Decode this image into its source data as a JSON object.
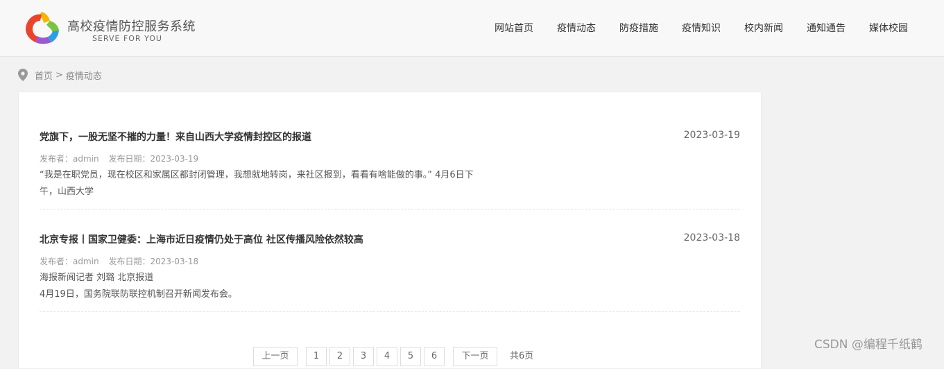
{
  "brand": {
    "title": "高校疫情防控服务系统",
    "subtitle": "SERVE FOR YOU"
  },
  "nav": {
    "items": [
      "网站首页",
      "疫情动态",
      "防疫措施",
      "疫情知识",
      "校内新闻",
      "通知通告",
      "媒体校园"
    ]
  },
  "breadcrumb": {
    "home": "首页",
    "separator": ">",
    "current": "疫情动态"
  },
  "articles": [
    {
      "title": "党旗下，一股无坚不摧的力量！来自山西大学疫情封控区的报道",
      "date": "2023-03-19",
      "author": "发布者：admin",
      "published": "发布日期：2023-03-19",
      "lines": [
        "“我是在职党员，现在校区和家属区都封闭管理，我想就地转岗，来社区报到，看看有啥能做的事。” 4月6日下",
        "午，山西大学"
      ]
    },
    {
      "title": "北京专报丨国家卫健委：上海市近日疫情仍处于高位 社区传播风险依然较高",
      "date": "2023-03-18",
      "author": "发布者：admin",
      "published": "发布日期：2023-03-18",
      "lines": [
        "海报新闻记者 刘璐 北京报道",
        "4月19日，国务院联防联控机制召开新闻发布会。"
      ]
    }
  ],
  "pagination": {
    "prev": "上一页",
    "pages": [
      "1",
      "2",
      "3",
      "4",
      "5",
      "6"
    ],
    "next": "下一页",
    "total": "共6页"
  },
  "watermark": "CSDN @编程千纸鹤",
  "colors": {
    "header_bg": "#f8f8f8",
    "page_bg": "#f2f2f2",
    "logo_red": "#e8452c",
    "logo_yellow": "#f7b500",
    "logo_green": "#7cc242",
    "logo_blue": "#2d9fe0",
    "logo_purple": "#9b59d0"
  },
  "icons": {
    "logo": "pentagon-swirl-logo",
    "breadcrumb": "map-pin-icon"
  }
}
